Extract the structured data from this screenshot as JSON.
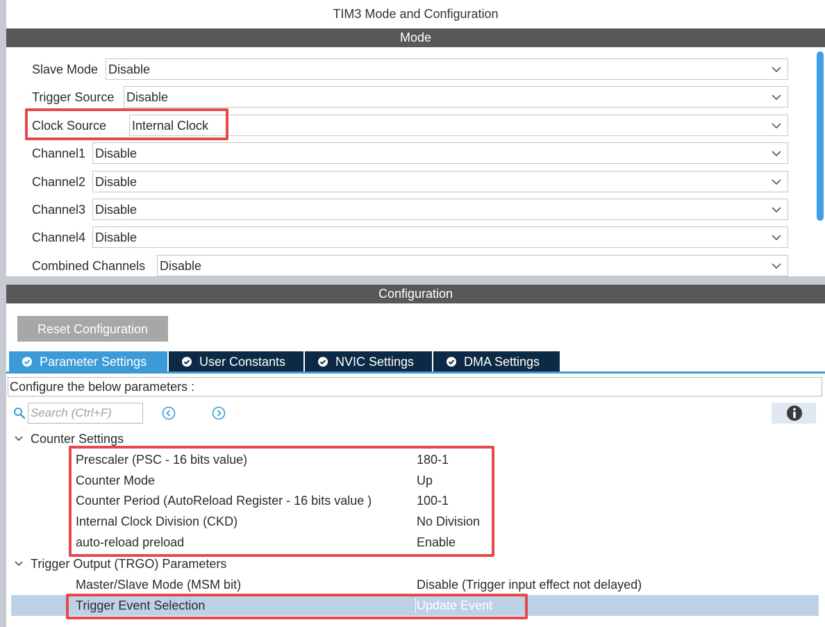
{
  "window": {
    "title": "TIM3 Mode and Configuration"
  },
  "mode": {
    "header": "Mode",
    "fields": [
      {
        "label": "Slave Mode",
        "value": "Disable"
      },
      {
        "label": "Trigger Source",
        "value": "Disable"
      },
      {
        "label": "Clock Source",
        "value": "Internal Clock"
      },
      {
        "label": "Channel1",
        "value": "Disable"
      },
      {
        "label": "Channel2",
        "value": "Disable"
      },
      {
        "label": "Channel3",
        "value": "Disable"
      },
      {
        "label": "Channel4",
        "value": "Disable"
      },
      {
        "label": "Combined Channels",
        "value": "Disable"
      }
    ]
  },
  "configuration": {
    "header": "Configuration",
    "reset_label": "Reset Configuration",
    "tabs": [
      {
        "label": "Parameter Settings",
        "active": true
      },
      {
        "label": "User Constants",
        "active": false
      },
      {
        "label": "NVIC Settings",
        "active": false
      },
      {
        "label": "DMA Settings",
        "active": false
      }
    ],
    "instruction": "Configure the below parameters :",
    "search_placeholder": "Search (Ctrl+F)",
    "groups": [
      {
        "label": "Counter Settings",
        "params": [
          {
            "name": "Prescaler (PSC - 16 bits value)",
            "value": "180-1"
          },
          {
            "name": "Counter Mode",
            "value": "Up"
          },
          {
            "name": "Counter Period (AutoReload Register - 16 bits value )",
            "value": "100-1"
          },
          {
            "name": "Internal Clock Division (CKD)",
            "value": "No Division"
          },
          {
            "name": "auto-reload preload",
            "value": "Enable"
          }
        ]
      },
      {
        "label": "Trigger Output (TRGO) Parameters",
        "params": [
          {
            "name": "Master/Slave Mode (MSM bit)",
            "value": "Disable (Trigger input effect not delayed)"
          },
          {
            "name": "Trigger Event Selection",
            "value": "Update Event"
          }
        ]
      }
    ]
  },
  "colors": {
    "section_bar": "#585858",
    "tab_active": "#3c9bd6",
    "tab_inactive": "#0c2a45",
    "highlight_box": "#e6484b",
    "selected_row": "#bdd2e7",
    "scrollbar": "#3ea0e6"
  },
  "icons": {
    "tab": "check-circle-icon",
    "search": "search-icon",
    "prev": "arrow-left-circle-icon",
    "next": "arrow-right-circle-icon",
    "info": "info-icon",
    "dropdown": "chevron-down-icon",
    "tree": "tree-expand-icon"
  }
}
